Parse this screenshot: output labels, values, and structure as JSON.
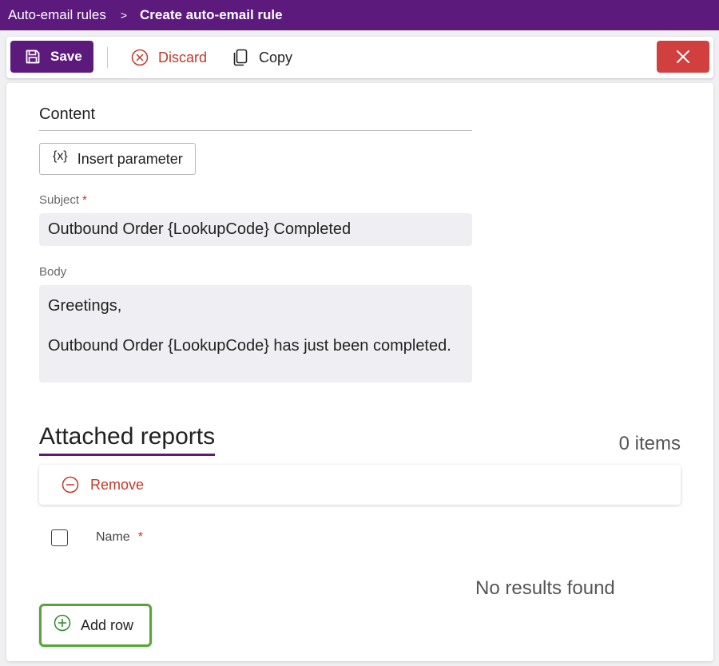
{
  "breadcrumb": {
    "parent": "Auto-email rules",
    "separator": ">",
    "current": "Create auto-email rule"
  },
  "toolbar": {
    "save_label": "Save",
    "discard_label": "Discard",
    "copy_label": "Copy"
  },
  "content": {
    "section_title": "Content",
    "insert_parameter_icon": "{x}",
    "insert_parameter_label": "Insert parameter",
    "subject": {
      "label": "Subject",
      "required_mark": "*",
      "value": "Outbound Order {LookupCode} Completed"
    },
    "body": {
      "label": "Body",
      "lines": [
        "Greetings,",
        "Outbound Order {LookupCode} has just been completed."
      ]
    }
  },
  "reports": {
    "title": "Attached reports",
    "items_count": "0 items",
    "remove_label": "Remove",
    "columns": [
      {
        "label": "Name",
        "required_mark": "*"
      }
    ],
    "empty_text": "No results found",
    "add_row_label": "Add row"
  },
  "colors": {
    "brand": "#5c1a7d",
    "danger": "#d13f3f",
    "discard_text": "#c0392b",
    "add_row_border": "#5aa33a"
  },
  "icons": {
    "save": "save-icon",
    "discard": "discard-icon",
    "copy": "copy-icon",
    "close": "close-icon",
    "remove": "remove-icon",
    "add": "add-icon"
  }
}
